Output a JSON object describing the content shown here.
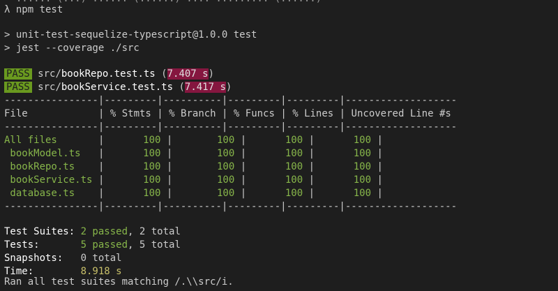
{
  "terminal": {
    "cut_top_line": "  ...... (...) ...... (......) .... ......... (......)",
    "prompt": "λ npm test",
    "npm_script_line": "> unit-test-sequelize-typescript@1.0.0 test",
    "npm_cmd_line": "> jest --coverage ./src",
    "suites": [
      {
        "status": "PASS",
        "dir": "src/",
        "file": "bookRepo.test.ts",
        "time": "7.407 s"
      },
      {
        "status": "PASS",
        "dir": "src/",
        "file": "bookService.test.ts",
        "time": "7.417 s"
      }
    ],
    "coverage": {
      "separator": "----------------|---------|----------|---------|---------|-------------------",
      "headers": [
        "File",
        "% Stmts",
        "% Branch",
        "% Funcs",
        "% Lines",
        "Uncovered Line #s"
      ],
      "rows": [
        {
          "file": "All files",
          "stmts": "100",
          "branch": "100",
          "funcs": "100",
          "lines": "100",
          "uncovered": ""
        },
        {
          "file": " bookModel.ts",
          "stmts": "100",
          "branch": "100",
          "funcs": "100",
          "lines": "100",
          "uncovered": ""
        },
        {
          "file": " bookRepo.ts",
          "stmts": "100",
          "branch": "100",
          "funcs": "100",
          "lines": "100",
          "uncovered": ""
        },
        {
          "file": " bookService.ts",
          "stmts": "100",
          "branch": "100",
          "funcs": "100",
          "lines": "100",
          "uncovered": ""
        },
        {
          "file": " database.ts",
          "stmts": "100",
          "branch": "100",
          "funcs": "100",
          "lines": "100",
          "uncovered": ""
        }
      ]
    },
    "summary": {
      "suites_label": "Test Suites: ",
      "suites_passed": "2 passed",
      "suites_total": ", 2 total",
      "tests_label": "Tests:       ",
      "tests_passed": "5 passed",
      "tests_total": ", 5 total",
      "snapshots_label": "Snapshots:   ",
      "snapshots_value": "0 total",
      "time_label": "Time:        ",
      "time_value": "8.918 s",
      "ran_line": "Ran all test suites matching /.\\\\src/i."
    },
    "cut_bottom_line": "...... ...  ..... ......... ..... ............. ................"
  },
  "colors": {
    "background": "#1e1e1e",
    "text": "#cccccc",
    "pass_badge": "#6a9a1f",
    "time_highlight": "#85163f",
    "coverage_green": "#87b64a",
    "summary_yellow": "#c8c06a"
  }
}
